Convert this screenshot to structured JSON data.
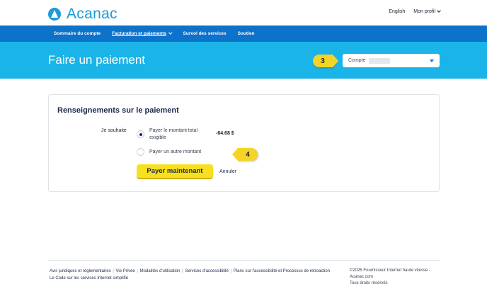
{
  "brand": {
    "name": "Acanac"
  },
  "top_links": {
    "language": "English",
    "profile": "Mon profil"
  },
  "nav": {
    "items": [
      {
        "label": "Sommaire du compte",
        "active": false
      },
      {
        "label": "Facturation et paiements",
        "active": true
      },
      {
        "label": "Survol des services",
        "active": false
      },
      {
        "label": "Soutien",
        "active": false
      }
    ]
  },
  "hero": {
    "title": "Faire un paiement"
  },
  "callouts": {
    "step3": "3",
    "step4": "4"
  },
  "account": {
    "label": "Compte"
  },
  "payment": {
    "title": "Renseignements sur le paiement",
    "wish_label": "Je souhaite",
    "options": [
      {
        "label": "Payer le montant total exigible",
        "selected": true,
        "amount": "-64.68 $"
      },
      {
        "label": "Payer un autre montant",
        "selected": false
      }
    ],
    "pay_button": "Payer maintenant",
    "cancel": "Annuler"
  },
  "footer": {
    "links": [
      "Avis juridiques et réglementaires",
      "Vie Privée",
      "Modalités d'utilisation",
      "Services d'accessibilité",
      "Plans sur l'accessibilité et Processus de retroaction",
      "Le Code sur les services Internet simplifié"
    ],
    "copyright": "©2025 Fournisseur Internet haute vitesse - Acanac.com",
    "rights": "Tous droits réservés"
  },
  "colors": {
    "nav": "#0d72c9",
    "hero": "#1ab4e8",
    "brand": "#1b9bd8",
    "button": "#f7e01f",
    "callout": "#f5d426"
  }
}
